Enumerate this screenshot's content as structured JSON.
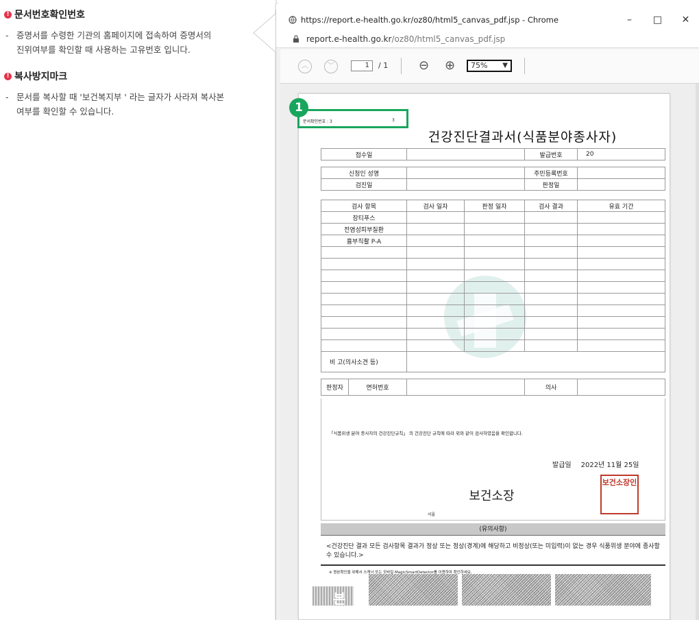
{
  "left": {
    "section1": {
      "title": "문서번호확인번호",
      "lines": [
        "증명서를 수령한 기관의 홈페이지에 접속하여 증명서의",
        "진위여부를 확인할 때 사용하는 고유번호 입니다."
      ]
    },
    "section2": {
      "title": "복사방지마크",
      "lines": [
        "문서를 복사할 때 '보건복지부 ' 라는 글자가 사라져 복사본",
        "여부를 확인할 수 있습니다."
      ]
    }
  },
  "browser": {
    "title": "https://report.e-health.go.kr/oz80/html5_canvas_pdf.jsp - Chrome",
    "url_host": "report.e-health.go.kr",
    "url_path": "/oz80/html5_canvas_pdf.jsp",
    "buttons": {
      "minimize": "–",
      "maximize": "□",
      "close": "✕"
    }
  },
  "toolbar": {
    "prev": "︿",
    "next": "﹀",
    "page": "1",
    "total": "/ 1",
    "zoom_out": "⊖",
    "zoom_in": "⊕",
    "zoom": "75%"
  },
  "doc": {
    "badge": "1",
    "docno_label": "문서확인번호 : 3",
    "docno_tail": "3",
    "title": "건강진단결과서(식품분야종사자)",
    "row1": {
      "a": "접수일",
      "b": "",
      "c": "발급번호",
      "d": "20"
    },
    "row2": {
      "a": "신청인 성명",
      "b": "",
      "c": "주민등록번호",
      "d": ""
    },
    "row3": {
      "a": "검진일",
      "b": "",
      "c": "판정일",
      "d": ""
    },
    "headers": [
      "검사 항목",
      "검사 일자",
      "판정 일자",
      "검사 결과",
      "유효 기간"
    ],
    "items": [
      "장티푸스",
      "전염성피부질환",
      "흉부직촬 P-A"
    ],
    "remarks": "비 고(의사소견 등)",
    "judge": {
      "a": "판정자",
      "b": "면허번호",
      "c": "의사"
    },
    "confirm": "「식품위생 분야 종사자의 건강진단규칙」 의 건강진단 규칙에 따라 위와 같이 검사하였음을 확인합니다.",
    "issue_label": "발급일",
    "issue_date": "2022년 11월 25일",
    "boss": "보건소장",
    "seal": "보건소장인",
    "sign_city": "서울",
    "notes_head": "(유의사항)",
    "notes_body": "<건강진단 결과 모든 검사항목 결과가 정상 또는 정상(경계)에 해당하고 비정상(또는 미입력)이 없는 경우 식품위생 분야에 종사할 수 있습니다.>",
    "small_note": "※ 원본확인을 위해서 스캐너 또는 모바일 MagicSmartDetector를 이용하여 확인하세요.",
    "bon": "본"
  }
}
